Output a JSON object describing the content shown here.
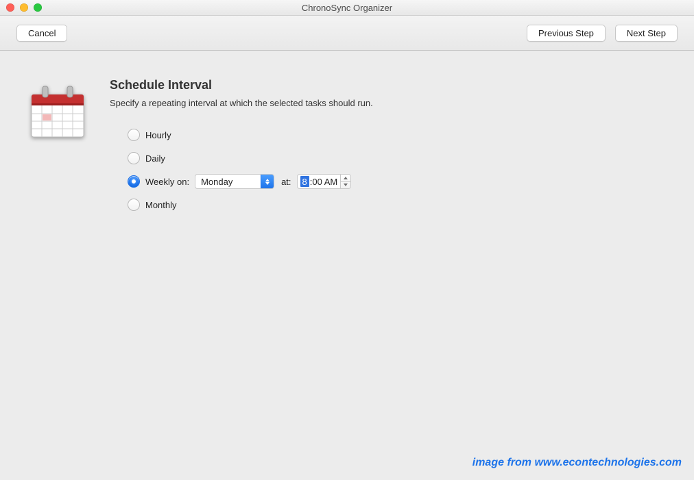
{
  "window": {
    "title": "ChronoSync Organizer"
  },
  "toolbar": {
    "cancel_label": "Cancel",
    "previous_label": "Previous Step",
    "next_label": "Next Step"
  },
  "section": {
    "title": "Schedule Interval",
    "description": "Specify a repeating interval at which the selected tasks should run."
  },
  "options": {
    "hourly": {
      "label": "Hourly",
      "selected": false
    },
    "daily": {
      "label": "Daily",
      "selected": false
    },
    "weekly": {
      "label": "Weekly on:",
      "selected": true
    },
    "monthly": {
      "label": "Monthly",
      "selected": false
    }
  },
  "weekly_detail": {
    "day_selected": "Monday",
    "at_label": "at:",
    "time_hour_highlighted": "8",
    "time_rest": ":00 AM"
  },
  "attribution": "image from www.econtechnologies.com"
}
